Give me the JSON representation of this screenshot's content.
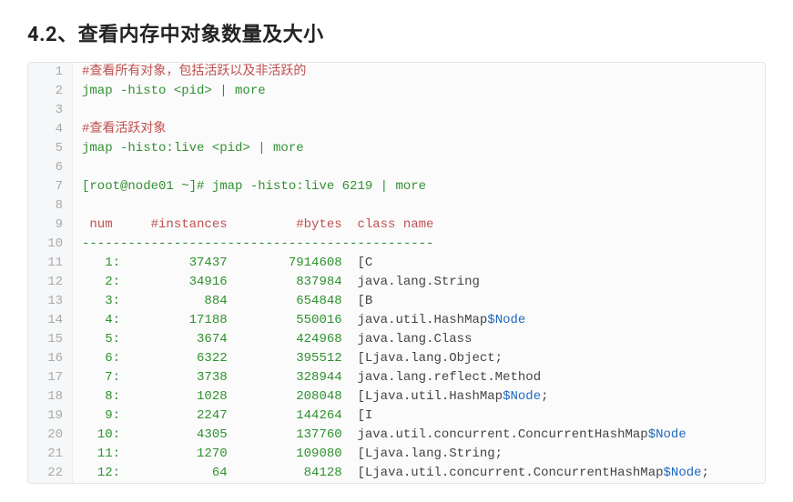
{
  "title": "4.2、查看内存中对象数量及大小",
  "code": {
    "lines": [
      {
        "n": 1,
        "segments": [
          {
            "cls": "c-comment",
            "text": "#查看所有对象，包括活跃以及非活跃的"
          }
        ]
      },
      {
        "n": 2,
        "segments": [
          {
            "cls": "c-cmd",
            "text": "jmap -histo <pid> | more"
          }
        ]
      },
      {
        "n": 3,
        "segments": []
      },
      {
        "n": 4,
        "segments": [
          {
            "cls": "c-comment",
            "text": "#查看活跃对象"
          }
        ]
      },
      {
        "n": 5,
        "segments": [
          {
            "cls": "c-cmd",
            "text": "jmap -histo:live <pid> | more"
          }
        ]
      },
      {
        "n": 6,
        "segments": []
      },
      {
        "n": 7,
        "segments": [
          {
            "cls": "c-cmd",
            "text": "[root@node01 ~]# jmap -histo:live 6219 | more"
          }
        ]
      },
      {
        "n": 8,
        "segments": []
      },
      {
        "n": 9,
        "segments": [
          {
            "cls": "c-header",
            "text": " num     #instances         #bytes  class name"
          }
        ]
      },
      {
        "n": 10,
        "segments": [
          {
            "cls": "c-dash",
            "text": "----------------------------------------------"
          }
        ]
      },
      {
        "n": 11,
        "segments": [
          {
            "cls": "c-num",
            "text": "   1:         37437        7914608"
          },
          {
            "cls": "c-class",
            "text": "  [C"
          }
        ]
      },
      {
        "n": 12,
        "segments": [
          {
            "cls": "c-num",
            "text": "   2:         34916         837984"
          },
          {
            "cls": "c-class",
            "text": "  java.lang.String"
          }
        ]
      },
      {
        "n": 13,
        "segments": [
          {
            "cls": "c-num",
            "text": "   3:           884         654848"
          },
          {
            "cls": "c-class",
            "text": "  [B"
          }
        ]
      },
      {
        "n": 14,
        "segments": [
          {
            "cls": "c-num",
            "text": "   4:         17188         550016"
          },
          {
            "cls": "c-class",
            "text": "  java.util.HashMap"
          },
          {
            "cls": "c-suffix",
            "text": "$Node"
          }
        ]
      },
      {
        "n": 15,
        "segments": [
          {
            "cls": "c-num",
            "text": "   5:          3674         424968"
          },
          {
            "cls": "c-class",
            "text": "  java.lang.Class"
          }
        ]
      },
      {
        "n": 16,
        "segments": [
          {
            "cls": "c-num",
            "text": "   6:          6322         395512"
          },
          {
            "cls": "c-class",
            "text": "  [Ljava.lang.Object;"
          }
        ]
      },
      {
        "n": 17,
        "segments": [
          {
            "cls": "c-num",
            "text": "   7:          3738         328944"
          },
          {
            "cls": "c-class",
            "text": "  java.lang.reflect.Method"
          }
        ]
      },
      {
        "n": 18,
        "segments": [
          {
            "cls": "c-num",
            "text": "   8:          1028         208048"
          },
          {
            "cls": "c-class",
            "text": "  [Ljava.util.HashMap"
          },
          {
            "cls": "c-suffix",
            "text": "$Node"
          },
          {
            "cls": "c-class",
            "text": ";"
          }
        ]
      },
      {
        "n": 19,
        "segments": [
          {
            "cls": "c-num",
            "text": "   9:          2247         144264"
          },
          {
            "cls": "c-class",
            "text": "  [I"
          }
        ]
      },
      {
        "n": 20,
        "segments": [
          {
            "cls": "c-num",
            "text": "  10:          4305         137760"
          },
          {
            "cls": "c-class",
            "text": "  java.util.concurrent.ConcurrentHashMap"
          },
          {
            "cls": "c-suffix",
            "text": "$Node"
          }
        ]
      },
      {
        "n": 21,
        "segments": [
          {
            "cls": "c-num",
            "text": "  11:          1270         109080"
          },
          {
            "cls": "c-class",
            "text": "  [Ljava.lang.String;"
          }
        ]
      },
      {
        "n": 22,
        "segments": [
          {
            "cls": "c-num",
            "text": "  12:            64          84128"
          },
          {
            "cls": "c-class",
            "text": "  [Ljava.util.concurrent.ConcurrentHashMap"
          },
          {
            "cls": "c-suffix",
            "text": "$Node"
          },
          {
            "cls": "c-class",
            "text": ";"
          }
        ]
      }
    ]
  }
}
